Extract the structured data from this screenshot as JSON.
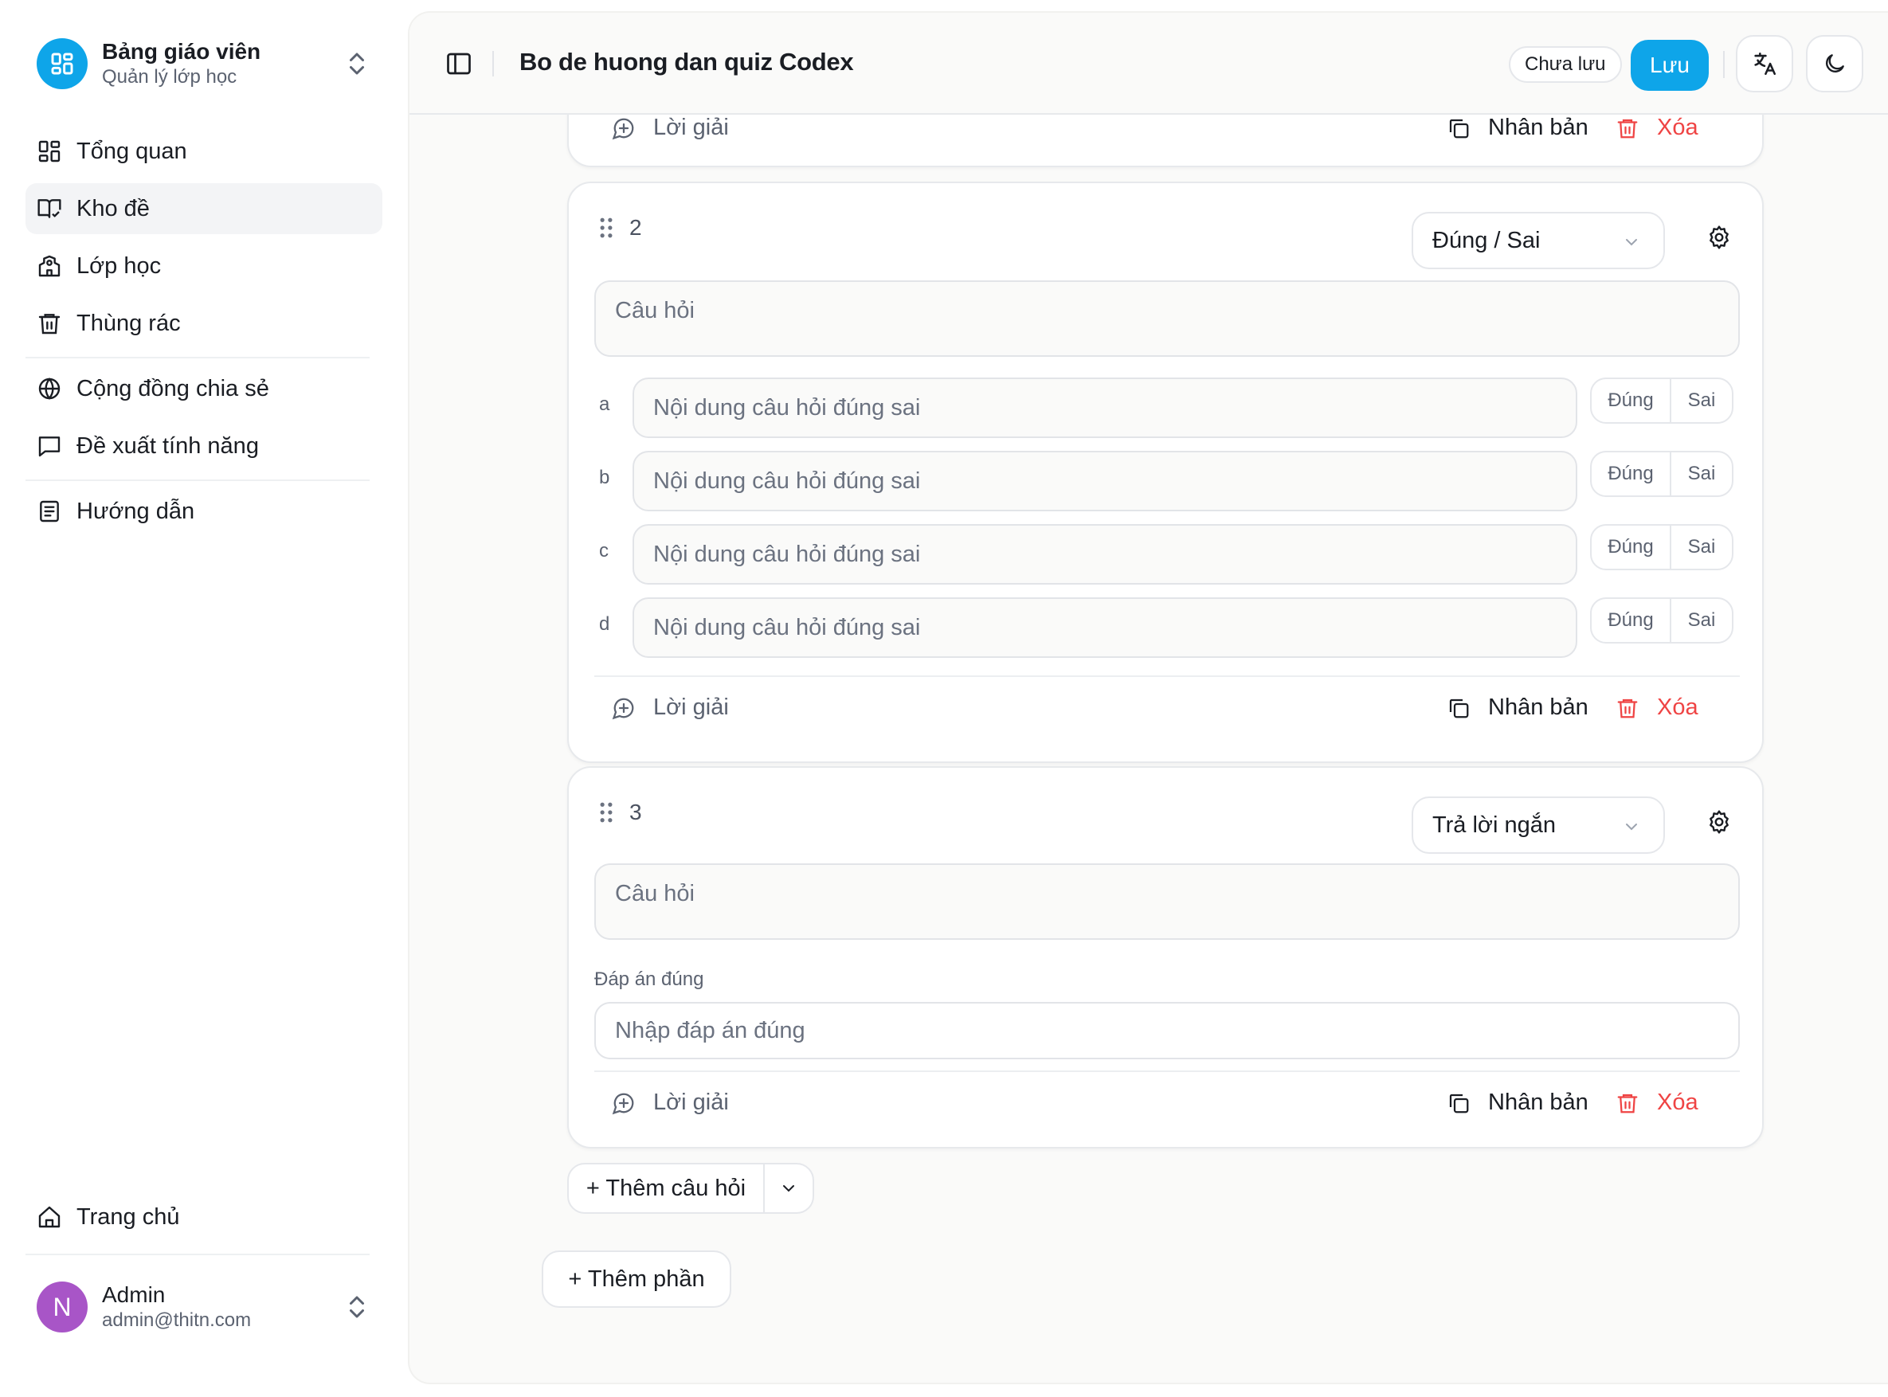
{
  "sidebar": {
    "brand_title": "Bảng giáo viên",
    "brand_subtitle": "Quản lý lớp học",
    "items": [
      {
        "label": "Tổng quan",
        "icon": "dashboard-icon"
      },
      {
        "label": "Kho đề",
        "icon": "book-icon",
        "active": true
      },
      {
        "label": "Lớp học",
        "icon": "school-icon"
      },
      {
        "label": "Thùng rác",
        "icon": "trash-icon"
      },
      {
        "label": "Cộng đồng chia sẻ",
        "icon": "globe-icon"
      },
      {
        "label": "Đề xuất tính năng",
        "icon": "message-icon"
      },
      {
        "label": "Hướng dẫn",
        "icon": "notebook-icon"
      }
    ],
    "home_label": "Trang chủ",
    "user": {
      "initial": "N",
      "name": "Admin",
      "email": "admin@thitn.com"
    }
  },
  "header": {
    "title": "Bo de huong dan quiz Codex",
    "status": "Chưa lưu",
    "save_label": "Lưu"
  },
  "colors": {
    "accent": "#0ea5e9",
    "danger": "#ef4444",
    "avatar": "#a855c7"
  },
  "card_actions": {
    "solution": "Lời giải",
    "duplicate": "Nhân bản",
    "delete": "Xóa"
  },
  "questions": [
    {
      "number": "2",
      "type": "Đúng / Sai",
      "placeholder": "Câu hỏi",
      "statements": [
        {
          "letter": "a",
          "placeholder": "Nội dung câu hỏi đúng sai"
        },
        {
          "letter": "b",
          "placeholder": "Nội dung câu hỏi đúng sai"
        },
        {
          "letter": "c",
          "placeholder": "Nội dung câu hỏi đúng sai"
        },
        {
          "letter": "d",
          "placeholder": "Nội dung câu hỏi đúng sai"
        }
      ],
      "true_label": "Đúng",
      "false_label": "Sai"
    },
    {
      "number": "3",
      "type": "Trả lời ngắn",
      "placeholder": "Câu hỏi",
      "answer_label": "Đáp án đúng",
      "answer_placeholder": "Nhập đáp án đúng"
    }
  ],
  "add_question_label": "+ Thêm câu hỏi",
  "add_section_label": "+ Thêm phần"
}
